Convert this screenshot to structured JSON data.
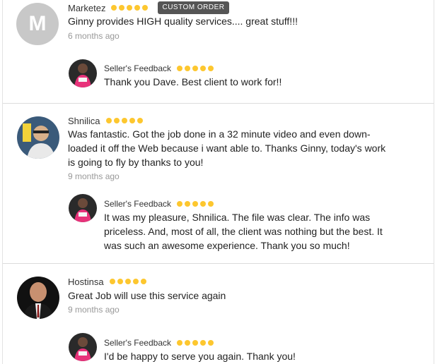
{
  "reviews": [
    {
      "avatar_letter": "M",
      "name": "Marketez",
      "rating": 5,
      "badge": "CUSTOM ORDER",
      "text": "Ginny provides HIGH quality services.... great stuff!!!",
      "time": "6 months ago",
      "seller_label": "Seller's Feedback",
      "seller_rating": 5,
      "seller_reply": "Thank you Dave. Best client to work for!!"
    },
    {
      "name": "Shnilica",
      "rating": 5,
      "text_lines": [
        "Was fantastic. Got the job done in a 32 minute video and even down-",
        "loaded it off the Web because i want able to. Thanks Ginny, today's work",
        "is going to fly by thanks to you!"
      ],
      "time": "9 months ago",
      "seller_label": "Seller's Feedback",
      "seller_rating": 5,
      "seller_reply_lines": [
        "It was my pleasure, Shnilica. The file was clear. The info was",
        "priceless. And, most of all, the client was nothing but the best. It",
        "was such an awesome experience. Thank you so much!"
      ]
    },
    {
      "name": "Hostinsa",
      "rating": 5,
      "text": "Great Job will use this service again",
      "time": "9 months ago",
      "seller_label": "Seller's Feedback",
      "seller_rating": 5,
      "seller_reply": "I'd be happy to serve you again. Thank you!"
    }
  ],
  "colors": {
    "star": "#fdc72f",
    "badge_bg": "#555555",
    "timestamp": "#999999"
  }
}
